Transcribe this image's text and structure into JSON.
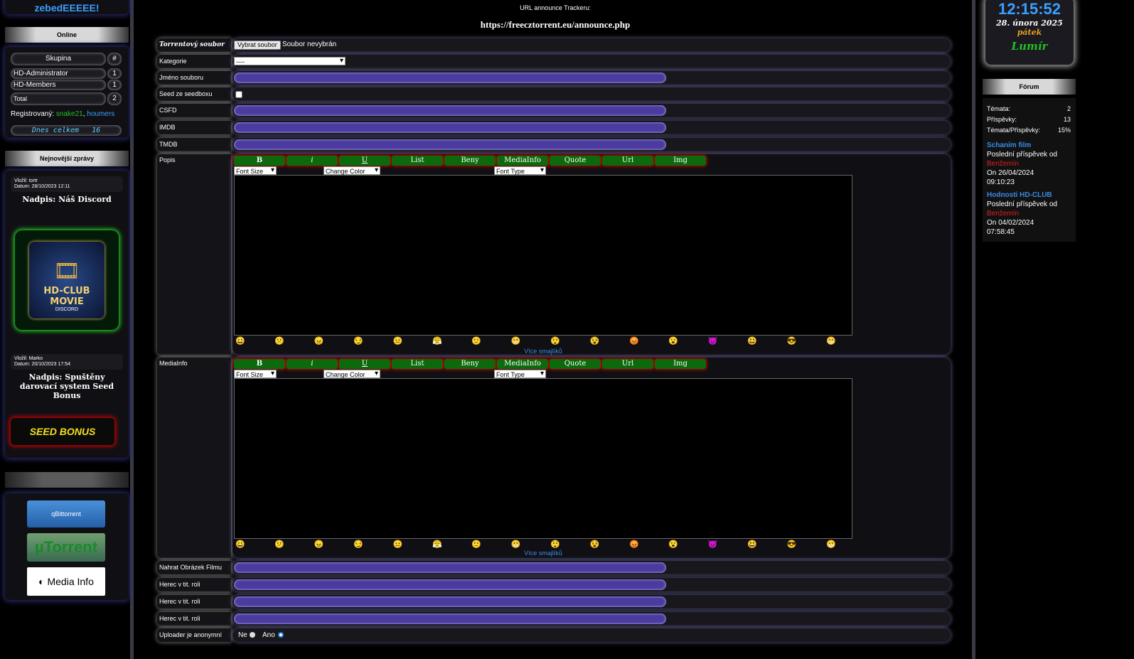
{
  "left": {
    "username": "zebedEEEEE!",
    "online": {
      "heading": "Online",
      "col_group": "Skupina",
      "col_count": "#",
      "rows": [
        {
          "name": "HD-Administrator",
          "count": "1"
        },
        {
          "name": "HD-Members",
          "count": "1"
        },
        {
          "name": "Total",
          "count": "2"
        }
      ],
      "registered_label": "Registrovaný:",
      "registered_user1": "snake21",
      "registered_sep": ",",
      "registered_user2": "houmers",
      "today_label": "Dnes celkem",
      "today_value": "16"
    },
    "news": {
      "heading": "Nejnovější zprávy",
      "items": [
        {
          "meta1": "Vložil: tortr",
          "meta2": "Datum: 28/10/2023 12:11",
          "title": "Nadpis: Náš Discord",
          "banner": "HD-CLUB MOVIE",
          "banner_sub": "DISCORD"
        },
        {
          "meta1": "Vložil: Marko",
          "meta2": "Datum: 20/10/2023 17:54",
          "title": "Nadpis: Spuštěny darovací system Seed Bonus",
          "banner": "SEED BONUS"
        }
      ]
    },
    "links": {
      "items": [
        "qBittorrent",
        "µTorrent",
        "Media Info"
      ]
    }
  },
  "main": {
    "announce_label": "URL announce Trackeru:",
    "announce_url": "https://freecztorrent.eu/announce.php",
    "fields": {
      "torrent_file": "Torrentový soubor",
      "choose_button": "Vybrat soubor",
      "no_file": "Soubor nevybrán",
      "category": "Kategorie",
      "category_value": "----",
      "file_name": "Jméno souboru",
      "seedbox": "Seed ze seedboxu",
      "csfd": "CSFD",
      "imdb": "IMDB",
      "tmdb": "TMDB",
      "popis": "Popis",
      "mediainfo": "MediaInfo",
      "upload_image": "Nahrat Obrázek Filmu",
      "actor": "Herec v tit. roli",
      "anonymous": "Uploader je anonymní",
      "no": "Ne",
      "yes": "Ano"
    },
    "editor": {
      "buttons": [
        "B",
        "i",
        "U",
        "List",
        "Beny",
        "MediaInfo",
        "Quote",
        "Url",
        "Img"
      ],
      "font_size": "Font Size",
      "change_color": "Change Color",
      "font_type": "Font Type",
      "more_smileys": "Více smajlíků",
      "smileys": [
        "😀",
        "😕",
        "😠",
        "😏",
        "😐",
        "😤",
        "🙂",
        "😬",
        "😲",
        "😵",
        "😡",
        "😮",
        "😈",
        "😃",
        "😎",
        "😁"
      ]
    }
  },
  "right": {
    "time": "12:15:52",
    "date": "28. února 2025",
    "weekday": "pátek",
    "nameday": "Lumír",
    "forum": {
      "heading": "Fórum",
      "stats": [
        {
          "label": "Témata:",
          "value": "2"
        },
        {
          "label": "Příspěvky:",
          "value": "13"
        },
        {
          "label": "Témata/Příspěvky:",
          "value": "15%"
        }
      ],
      "topics": [
        {
          "title": "Schaním film",
          "last": "Poslední příspěvek od",
          "author": "Benžemín",
          "date": "On 26/04/2024",
          "time": "09:10:23"
        },
        {
          "title": "Hodnosti HD-CLUB",
          "last": "Poslední příspěvek od",
          "author": "Benžemín",
          "date": "On 04/02/2024",
          "time": "07:58:45"
        }
      ]
    }
  },
  "colors": {
    "accent_purple": "#4c3b9e",
    "bb_green": "#0c6a0c",
    "link_blue": "#3a8ae6",
    "author_red": "#e02020"
  }
}
